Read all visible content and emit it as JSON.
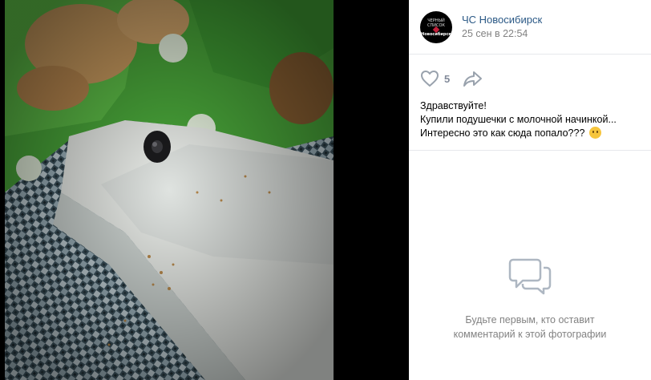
{
  "post": {
    "author": "ЧС Новосибирск",
    "date": "25 сен в 22:54",
    "avatar_text": "ЧЕРНЫЙ\nСПИСОК",
    "avatar_city": "Новосибирск",
    "likes": "5",
    "caption_lines": [
      "Здравствуйте!",
      "Купили подушечки с молочной начинкой...",
      "Интересно это как сюда попало???"
    ]
  },
  "comments": {
    "empty_line1": "Будьте первым, кто оставит",
    "empty_line2": "комментарий к этой фотографии"
  },
  "icons": {
    "like": "heart-icon",
    "share": "share-arrow-icon",
    "comments": "speech-bubbles-icon",
    "emoji": "smile-emoji-icon"
  },
  "colors": {
    "link": "#2a5885",
    "muted": "#828282",
    "icon": "#99a2ad",
    "divider": "#e7e8ec"
  }
}
